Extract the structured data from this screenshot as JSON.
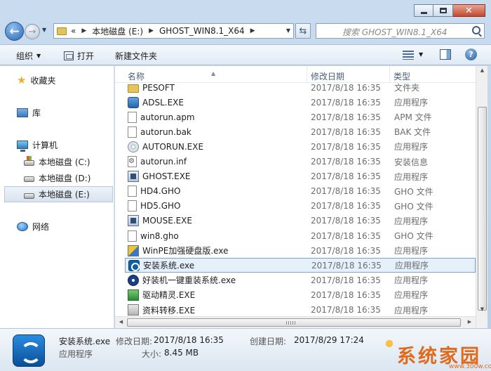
{
  "address": {
    "history_glyph": "«",
    "crumbs": [
      "本地磁盘 (E:)",
      "GHOST_WIN8.1_X64"
    ]
  },
  "search": {
    "placeholder": "搜索 GHOST_WIN8.1_X64"
  },
  "toolbar": {
    "organize": "组织",
    "open": "打开",
    "new_folder": "新建文件夹"
  },
  "sidebar": {
    "favorites": "收藏夹",
    "library": "库",
    "computer": "计算机",
    "drive_c": "本地磁盘 (C:)",
    "drive_d": "本地磁盘 (D:)",
    "drive_e": "本地磁盘 (E:)",
    "network": "网络"
  },
  "columns": {
    "name": "名称",
    "date": "修改日期",
    "type": "类型"
  },
  "files": [
    {
      "name": "PESOFT",
      "date": "2017/8/18 16:35",
      "type": "文件夹",
      "icon": "folder-icon"
    },
    {
      "name": "ADSL.EXE",
      "date": "2017/8/18 16:35",
      "type": "应用程序",
      "icon": "app-icon"
    },
    {
      "name": "autorun.apm",
      "date": "2017/8/18 16:35",
      "type": "APM 文件",
      "icon": "document-icon"
    },
    {
      "name": "autorun.bak",
      "date": "2017/8/18 16:35",
      "type": "BAK 文件",
      "icon": "document-icon"
    },
    {
      "name": "AUTORUN.EXE",
      "date": "2017/8/18 16:35",
      "type": "应用程序",
      "icon": "cd-icon"
    },
    {
      "name": "autorun.inf",
      "date": "2017/8/18 16:35",
      "type": "安装信息",
      "icon": "settings-file-icon"
    },
    {
      "name": "GHOST.EXE",
      "date": "2017/8/18 16:35",
      "type": "应用程序",
      "icon": "ghost-icon"
    },
    {
      "name": "HD4.GHO",
      "date": "2017/8/18 16:35",
      "type": "GHO 文件",
      "icon": "document-icon"
    },
    {
      "name": "HD5.GHO",
      "date": "2017/8/18 16:35",
      "type": "GHO 文件",
      "icon": "document-icon"
    },
    {
      "name": "MOUSE.EXE",
      "date": "2017/8/18 16:35",
      "type": "应用程序",
      "icon": "ghost-icon"
    },
    {
      "name": "win8.gho",
      "date": "2017/8/18 16:35",
      "type": "GHO 文件",
      "icon": "document-icon"
    },
    {
      "name": "WinPE加强硬盘版.exe",
      "date": "2017/8/18 16:35",
      "type": "应用程序",
      "icon": "winpe-icon"
    },
    {
      "name": "安装系统.exe",
      "date": "2017/8/18 16:35",
      "type": "应用程序",
      "icon": "install-icon"
    },
    {
      "name": "好装机一键重装系统.exe",
      "date": "2017/8/18 16:35",
      "type": "应用程序",
      "icon": "haozhuang-icon"
    },
    {
      "name": "驱动精灵.EXE",
      "date": "2017/8/18 16:35",
      "type": "应用程序",
      "icon": "driver-icon"
    },
    {
      "name": "资料转移.EXE",
      "date": "2017/8/18 16:35",
      "type": "应用程序",
      "icon": "transfer-icon"
    }
  ],
  "selected_index": 12,
  "details": {
    "name": "安装系统.exe",
    "type": "应用程序",
    "modified_label": "修改日期:",
    "modified_value": "2017/8/18 16:35",
    "created_label": "创建日期:",
    "created_value": "2017/8/29 17:24",
    "size_label": "大小:",
    "size_value": "8.45 MB"
  },
  "watermark": {
    "text": "系统家园",
    "url": "www.300w.com"
  }
}
